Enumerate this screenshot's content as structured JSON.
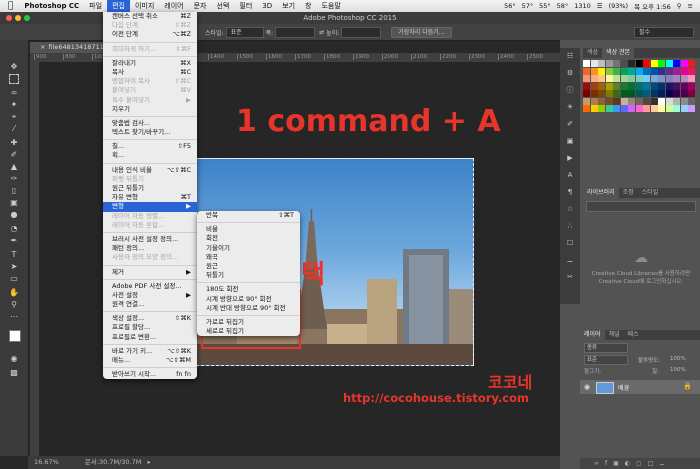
{
  "menubar": {
    "app": "Photoshop CC",
    "items": [
      "파일",
      "편집",
      "이미지",
      "레이어",
      "문자",
      "선택",
      "필터",
      "3D",
      "보기",
      "창",
      "도움말"
    ],
    "active_index": 1,
    "status": [
      "56°",
      "57°",
      "55°",
      "58°",
      "1310",
      "(93%)",
      "목 오후 1:56"
    ]
  },
  "window": {
    "title": "Adobe Photoshop CC 2015"
  },
  "options_bar": {
    "style_label": "스타일:",
    "style_value": "표준",
    "width_label": "폭:",
    "height_label": "높이:",
    "refine_button": "가장자리 다듬기...",
    "workspace": "필수"
  },
  "document": {
    "tab": "file6481341871160.j...",
    "ruler_ticks": [
      "900",
      "800",
      "1000",
      "1100",
      "1200",
      "1300",
      "1400",
      "1500",
      "1600",
      "1700",
      "1800",
      "1900",
      "2000",
      "2100",
      "2200",
      "2300",
      "2400",
      "2500"
    ],
    "zoom": "16.67%",
    "doc_info": "문서:30.7M/30.7M"
  },
  "panels": {
    "swatch_tabs": [
      "색상",
      "색상 견본"
    ],
    "library_tabs": [
      "라이브러리",
      "조정",
      "스타일"
    ],
    "cc_message_1": "Creative Cloud Libraries를 사용하려면",
    "cc_message_2": "Creative Cloud에 로그인하십시오.",
    "layer_tabs": [
      "레이어",
      "채널",
      "패스"
    ],
    "layer_kind": "종류",
    "blend_mode": "표준",
    "opacity_label": "불투명도:",
    "opacity": "100%",
    "lock_label": "잠그기:",
    "fill_label": "칠:",
    "fill": "100%",
    "layer_name": "배경",
    "colors": {
      "swatches": [
        "#ffffff",
        "#e6e6e6",
        "#bfbfbf",
        "#999999",
        "#737373",
        "#4d4d4d",
        "#262626",
        "#000000",
        "#ff0000",
        "#ffff00",
        "#00ff00",
        "#00ffff",
        "#0000ff",
        "#ff00ff",
        "#ed1c24",
        "#f26522",
        "#f7941d",
        "#fff200",
        "#8dc63f",
        "#39b54a",
        "#00a651",
        "#00a99d",
        "#00aeef",
        "#0072bc",
        "#0054a6",
        "#2e3192",
        "#662d91",
        "#92278f",
        "#ec008c",
        "#ed145b",
        "#f69679",
        "#f9ad81",
        "#fdc689",
        "#fff799",
        "#c4df9b",
        "#a3d39c",
        "#82ca9c",
        "#7accc8",
        "#6dcff6",
        "#7da7d9",
        "#8393ca",
        "#8781bd",
        "#a186be",
        "#bd8cbf",
        "#f49ac1",
        "#9e0b0f",
        "#a0410d",
        "#a36209",
        "#aba000",
        "#598527",
        "#1a7b30",
        "#007236",
        "#00746b",
        "#0076a3",
        "#004a80",
        "#003471",
        "#1b1464",
        "#440e62",
        "#630460",
        "#9e005d",
        "#790000",
        "#7b2e00",
        "#7d4900",
        "#827b00",
        "#406618",
        "#005e20",
        "#005826",
        "#005952",
        "#005b7f",
        "#003663",
        "#002157",
        "#0d004c",
        "#32004b",
        "#4b0049",
        "#7b0046",
        "#c69c6d",
        "#a67c52",
        "#8c6239",
        "#754c24",
        "#603913",
        "#c7b299",
        "#998675",
        "#736357",
        "#534741",
        "#362f2d",
        "#ffffff",
        "#d9d9d9",
        "#b3b3b3",
        "#8c8c8c",
        "#666666",
        "#ff6600",
        "#ffcc00",
        "#99cc00",
        "#33cc99",
        "#3399ff",
        "#6666ff",
        "#cc66ff",
        "#ff66cc",
        "#ff9999",
        "#ffcc99",
        "#ffff99",
        "#ccff99",
        "#99ffcc",
        "#99ccff",
        "#cc99ff"
      ]
    }
  },
  "edit_menu": [
    {
      "label": "캔버스 선택 취소",
      "sc": "⌘Z",
      "dis": false
    },
    {
      "label": "다음 단계",
      "sc": "⇧⌘Z",
      "dis": true
    },
    {
      "label": "이전 단계",
      "sc": "⌥⌘Z",
      "dis": false
    },
    {
      "sep": true
    },
    {
      "label": "희미하게 하기...",
      "sc": "⇧⌘F",
      "dis": true
    },
    {
      "sep": true
    },
    {
      "label": "잘라내기",
      "sc": "⌘X",
      "dis": false
    },
    {
      "label": "복사",
      "sc": "⌘C",
      "dis": false
    },
    {
      "label": "병합하여 복사",
      "sc": "⇧⌘C",
      "dis": true
    },
    {
      "label": "붙여넣기",
      "sc": "⌘V",
      "dis": true
    },
    {
      "label": "특수 붙여넣기",
      "sc": "▶",
      "dis": true
    },
    {
      "label": "지우기",
      "sc": "",
      "dis": false
    },
    {
      "sep": true
    },
    {
      "label": "맞춤법 검사...",
      "sc": "",
      "dis": false
    },
    {
      "label": "텍스트 찾기/바꾸기...",
      "sc": "",
      "dis": false
    },
    {
      "sep": true
    },
    {
      "label": "칠...",
      "sc": "⇧F5",
      "dis": false
    },
    {
      "label": "획...",
      "sc": "",
      "dis": false
    },
    {
      "sep": true
    },
    {
      "label": "내용 인식 비율",
      "sc": "⌥⇧⌘C",
      "dis": false
    },
    {
      "label": "퍼펫 뒤틀기",
      "sc": "",
      "dis": true
    },
    {
      "label": "원근 뒤틀기",
      "sc": "",
      "dis": false
    },
    {
      "label": "자유 변형",
      "sc": "⌘T",
      "dis": false
    },
    {
      "label": "변형",
      "sc": "▶",
      "dis": false,
      "hl": true
    },
    {
      "label": "레이어 자동 정렬...",
      "sc": "",
      "dis": true
    },
    {
      "label": "레이어 자동 혼합...",
      "sc": "",
      "dis": true
    },
    {
      "sep": true
    },
    {
      "label": "브러시 사전 설정 정의...",
      "sc": "",
      "dis": false
    },
    {
      "label": "패턴 정의...",
      "sc": "",
      "dis": false
    },
    {
      "label": "사용자 정의 모양 정의...",
      "sc": "",
      "dis": true
    },
    {
      "sep": true
    },
    {
      "label": "제거",
      "sc": "▶",
      "dis": false
    },
    {
      "sep": true
    },
    {
      "label": "Adobe PDF 사전 설정...",
      "sc": "",
      "dis": false
    },
    {
      "label": "사전 설정",
      "sc": "▶",
      "dis": false
    },
    {
      "label": "원격 연결...",
      "sc": "",
      "dis": false
    },
    {
      "sep": true
    },
    {
      "label": "색상 설정...",
      "sc": "⇧⌘K",
      "dis": false
    },
    {
      "label": "프로필 할당...",
      "sc": "",
      "dis": false
    },
    {
      "label": "프로필로 변환...",
      "sc": "",
      "dis": false
    },
    {
      "sep": true
    },
    {
      "label": "바로 가기 키...",
      "sc": "⌥⇧⌘K",
      "dis": false
    },
    {
      "label": "메뉴...",
      "sc": "⌥⇧⌘M",
      "dis": false
    },
    {
      "sep": true
    },
    {
      "label": "받아쓰기 시작...",
      "sc": "fn fn",
      "dis": false
    }
  ],
  "transform_menu": [
    {
      "label": "반복",
      "sc": "⇧⌘T",
      "dis": false
    },
    {
      "sep": true
    },
    {
      "label": "비율",
      "sc": "",
      "dis": false
    },
    {
      "label": "회전",
      "sc": "",
      "dis": false
    },
    {
      "label": "기울이기",
      "sc": "",
      "dis": false
    },
    {
      "label": "왜곡",
      "sc": "",
      "dis": false
    },
    {
      "label": "원근",
      "sc": "",
      "dis": false
    },
    {
      "label": "뒤틀기",
      "sc": "",
      "dis": false
    },
    {
      "sep": true
    },
    {
      "label": "180도 회전",
      "sc": "",
      "dis": false
    },
    {
      "label": "시계 방향으로 90° 회전",
      "sc": "",
      "dis": false
    },
    {
      "label": "시계 반대 방향으로 90° 회전",
      "sc": "",
      "dis": false
    },
    {
      "sep": true
    },
    {
      "label": "가로로 뒤집기",
      "sc": "",
      "dis": false
    },
    {
      "label": "세로로 뒤집기",
      "sc": "",
      "dis": false
    }
  ],
  "annotations": {
    "step1": "1  command + A",
    "step2": "2 선택",
    "author": "코코네",
    "url": "http://cocohouse.tistory.com",
    "color": "#e8352b"
  }
}
